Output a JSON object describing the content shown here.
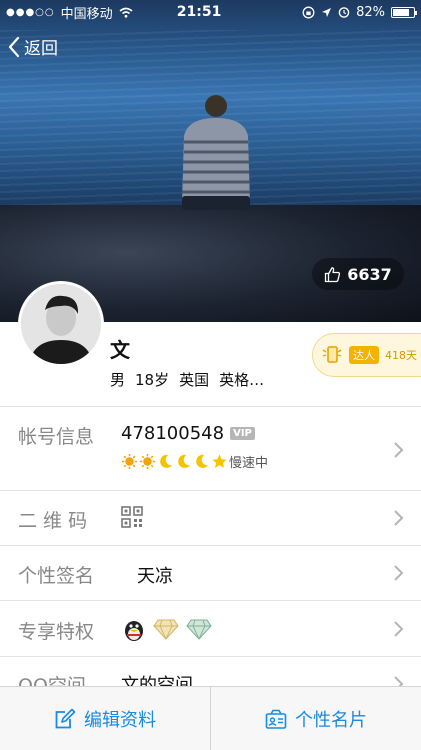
{
  "status_bar": {
    "carrier": "中国移动",
    "time": "21:51",
    "battery": "82%",
    "battery_level": 0.82
  },
  "nav": {
    "back_label": "返回"
  },
  "cover": {
    "likes": "6637"
  },
  "profile": {
    "name": "文",
    "gender": "男",
    "age": "18岁",
    "country": "英国",
    "city": "英格…",
    "badge_tag": "达人",
    "badge_days": "418天"
  },
  "rows": {
    "account": {
      "label": "帐号信息",
      "qq_number": "478100548",
      "vip_tag": "VIP",
      "speed_text": "慢速中",
      "level_icons": [
        "sun",
        "sun",
        "moon",
        "moon",
        "moon",
        "star"
      ]
    },
    "qrcode": {
      "label": "二 维 码"
    },
    "signature": {
      "label": "个性签名",
      "value": "天凉"
    },
    "privileges": {
      "label": "专享特权",
      "icons": [
        "qq-penguin",
        "diamond-yellow",
        "diamond-green"
      ]
    },
    "qzone": {
      "label": "QQ空间",
      "value": "文的空间"
    }
  },
  "toolbar": {
    "edit_label": "编辑资料",
    "card_label": "个性名片"
  },
  "colors": {
    "accent": "#1a8be0",
    "label_gray": "#888888",
    "badge_gold": "#f3b300"
  }
}
